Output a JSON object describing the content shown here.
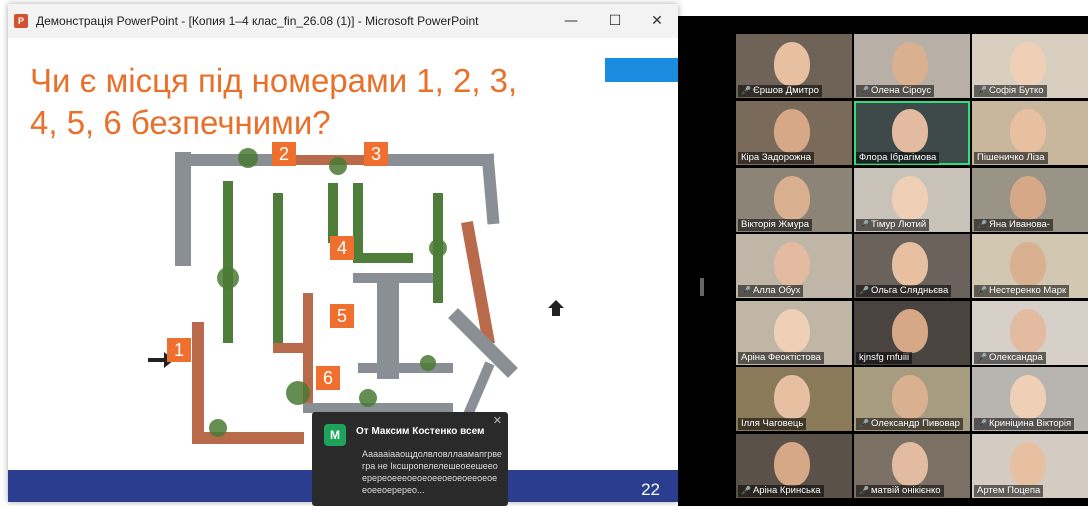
{
  "window": {
    "app_icon": "P",
    "title": "Демонстрація PowerPoint - [Копия 1–4 клас_fin_26.08 (1)] - Microsoft PowerPoint",
    "controls": {
      "minimize": "—",
      "maximize": "☐",
      "close": "✕"
    }
  },
  "slide": {
    "title_line1": "Чи є місця під номерами 1, 2, 3,",
    "title_line2": "4, 5, 6 безпечними?",
    "slide_number": "22",
    "markers": [
      "1",
      "2",
      "3",
      "4",
      "5",
      "6"
    ],
    "colors": {
      "title": "#e8702a",
      "marker": "#ef6f2e",
      "footer": "#2b3d8f",
      "accent": "#1a8de0"
    }
  },
  "chat": {
    "avatar": "М",
    "from": "От Максим Костенко всем",
    "close": "✕",
    "message": "Аааааіааощдолвловллаамапгрвегра не Іксшропелелешеоеешееоеререоеееоеоеоееоеоеоееоеоееоееоеререо..."
  },
  "gallery": {
    "participants": [
      {
        "name": "Єршов Дмитро",
        "muted": true,
        "active": false
      },
      {
        "name": "Олена Сіроус",
        "muted": true,
        "active": false
      },
      {
        "name": "Софія Бутко",
        "muted": true,
        "active": false
      },
      {
        "name": "Кіра Задорожна",
        "muted": false,
        "active": false
      },
      {
        "name": "Флора Ібрагімова",
        "muted": false,
        "active": true
      },
      {
        "name": "Пішеничко Ліза",
        "muted": false,
        "active": false
      },
      {
        "name": "Вікторія Жмура",
        "muted": false,
        "active": false
      },
      {
        "name": "Тімур Лютий",
        "muted": true,
        "active": false
      },
      {
        "name": "Яна Иванова-",
        "muted": true,
        "active": false
      },
      {
        "name": "Алла Обух",
        "muted": true,
        "active": false
      },
      {
        "name": "Ольга Слядньєва",
        "muted": true,
        "active": false
      },
      {
        "name": "Нестеренко Марк",
        "muted": true,
        "active": false
      },
      {
        "name": "Аріна Феоктістова",
        "muted": false,
        "active": false
      },
      {
        "name": "kjnsfg rnfuiii",
        "muted": false,
        "active": false
      },
      {
        "name": "Олександра",
        "muted": true,
        "active": false
      },
      {
        "name": "Ілля Чаговець",
        "muted": false,
        "active": false
      },
      {
        "name": "Олександр Пивовар",
        "muted": true,
        "active": false
      },
      {
        "name": "Криніцина Вікторія",
        "muted": true,
        "active": false
      },
      {
        "name": "Аріна Кринська",
        "muted": true,
        "active": false
      },
      {
        "name": "матвій онікієнко",
        "muted": true,
        "active": false
      },
      {
        "name": "Артем Поцепа",
        "muted": false,
        "active": false
      }
    ]
  }
}
